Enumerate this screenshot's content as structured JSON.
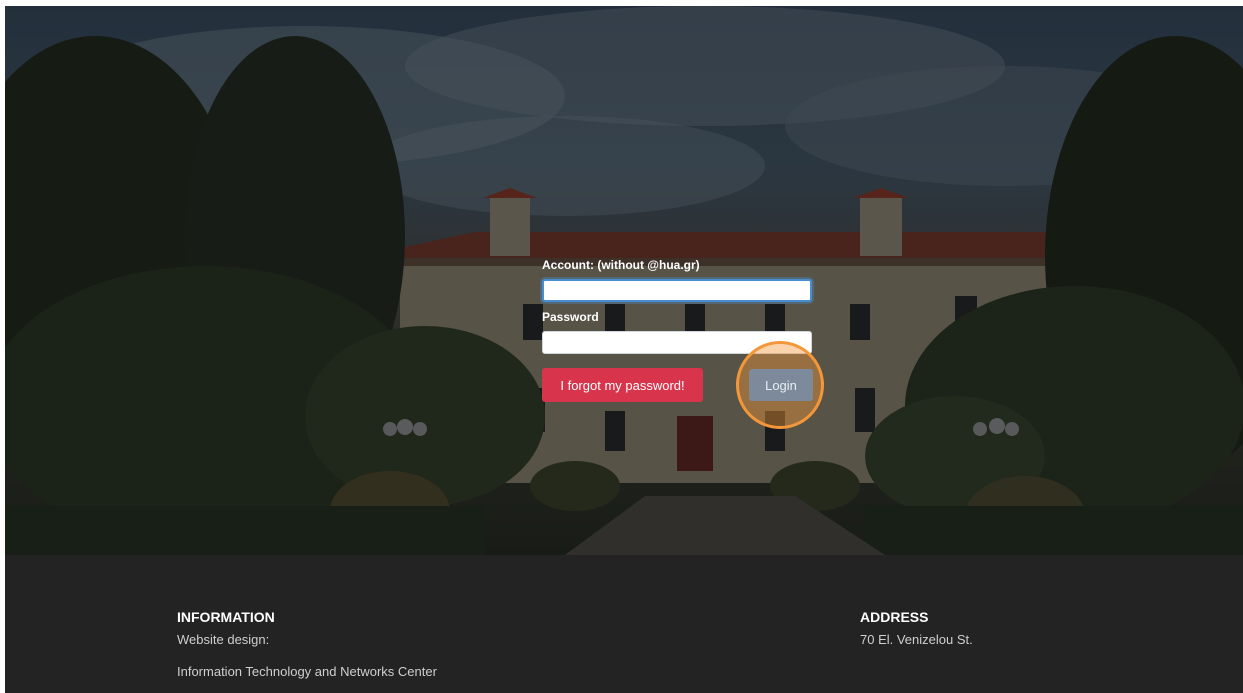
{
  "login": {
    "account_label": "Account: (without @hua.gr)",
    "account_value": "",
    "password_label": "Password",
    "password_value": "",
    "forgot_button": "I forgot my password!",
    "login_button": "Login"
  },
  "footer": {
    "information": {
      "heading": "INFORMATION",
      "line1": "Website design:",
      "line2": "Information Technology and Networks Center"
    },
    "address": {
      "heading": "ADDRESS",
      "line1": "70 El. Venizelou St."
    }
  },
  "colors": {
    "forgot_button": "#d8344c",
    "login_button": "#7d8a9c",
    "footer_bg": "#232323",
    "click_indicator": "#f3973a"
  }
}
